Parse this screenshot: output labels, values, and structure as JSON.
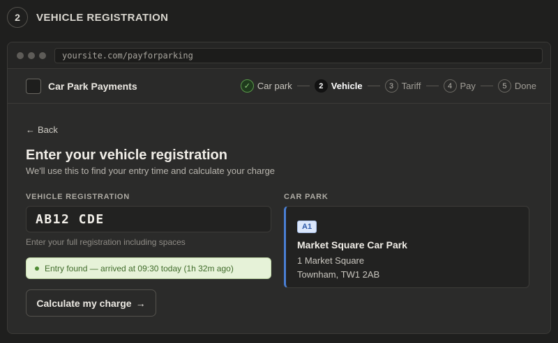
{
  "section": {
    "number": "2",
    "title": "VEHICLE REGISTRATION"
  },
  "browser": {
    "url": "yoursite.com/payforparking"
  },
  "app": {
    "name": "Car Park Payments"
  },
  "steps": [
    {
      "marker": "✓",
      "label": "Car park",
      "state": "done"
    },
    {
      "marker": "2",
      "label": "Vehicle",
      "state": "active"
    },
    {
      "marker": "3",
      "label": "Tariff",
      "state": "upcoming"
    },
    {
      "marker": "4",
      "label": "Pay",
      "state": "upcoming"
    },
    {
      "marker": "5",
      "label": "Done",
      "state": "upcoming"
    }
  ],
  "main": {
    "back_label": "Back",
    "title": "Enter your vehicle registration",
    "subtitle": "We'll use this to find your entry time and calculate your charge",
    "reg_label": "VEHICLE REGISTRATION",
    "reg_value": "AB12 CDE",
    "reg_hint": "Enter your full registration including spaces",
    "entry_status": "Entry found — arrived at 09:30 today (1h 32m ago)",
    "calc_button": "Calculate my charge",
    "car_park_label": "CAR PARK"
  },
  "car_park": {
    "code": "A1",
    "name": "Market Square Car Park",
    "address_line1": "1 Market Square",
    "address_line2": "Townham, TW1 2AB"
  },
  "colors": {
    "accent": "#4a7fd4",
    "success": "#4f8a34",
    "background": "#1f1f1e"
  }
}
